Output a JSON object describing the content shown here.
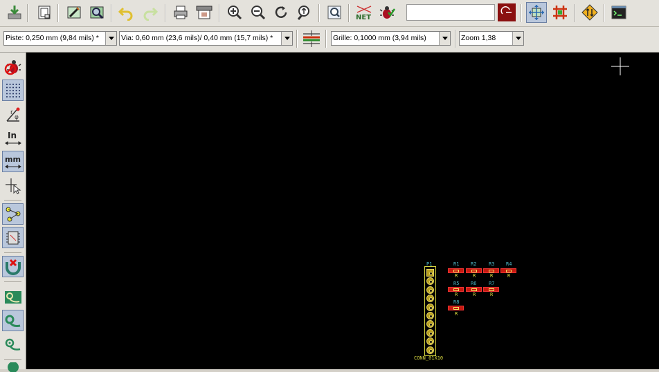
{
  "toolbar": {
    "buttons": [
      {
        "name": "save-board-icon",
        "label": ""
      },
      {
        "name": "page-settings-icon",
        "label": ""
      },
      {
        "name": "load-module-icon",
        "label": ""
      },
      {
        "name": "module-editor-icon",
        "label": ""
      },
      {
        "name": "undo-icon",
        "label": ""
      },
      {
        "name": "redo-icon",
        "label": ""
      },
      {
        "name": "print-icon",
        "label": ""
      },
      {
        "name": "plot-icon",
        "label": ""
      },
      {
        "name": "zoom-in-icon",
        "label": ""
      },
      {
        "name": "zoom-out-icon",
        "label": ""
      },
      {
        "name": "redraw-icon",
        "label": ""
      },
      {
        "name": "zoom-fit-icon",
        "label": ""
      },
      {
        "name": "find-icon",
        "label": ""
      },
      {
        "name": "netlist-icon",
        "label": "NET"
      },
      {
        "name": "drc-icon",
        "label": ""
      },
      {
        "name": "layer-color-icon",
        "label": ""
      },
      {
        "name": "mode-module-icon",
        "label": ""
      },
      {
        "name": "mode-track-icon",
        "label": ""
      },
      {
        "name": "autoroute-icon",
        "label": ""
      },
      {
        "name": "python-console-icon",
        "label": ""
      }
    ],
    "search_value": ""
  },
  "options": {
    "track_width": "Piste: 0,250 mm (9,84 mils) *",
    "via_size": "Via: 0,60 mm (23,6 mils)/ 0,40 mm (15,7 mils) *",
    "grid": "Grille: 0,1000 mm (3,94 mils)",
    "zoom": "Zoom 1,38"
  },
  "board": {
    "connector": {
      "ref": "P1",
      "value": "CONN_01X10",
      "pins": 10
    },
    "resistors_row1": [
      {
        "ref": "R1",
        "value": "R"
      },
      {
        "ref": "R2",
        "value": "R"
      },
      {
        "ref": "R3",
        "value": "R"
      },
      {
        "ref": "R4",
        "value": "R"
      }
    ],
    "resistors_row2": [
      {
        "ref": "R5",
        "value": "R"
      },
      {
        "ref": "R6",
        "value": "R"
      },
      {
        "ref": "R7",
        "value": "R"
      }
    ],
    "resistors_row3": [
      {
        "ref": "R8",
        "value": "R"
      }
    ]
  },
  "colors": {
    "canvas": "#000000",
    "pad": "#c61a10",
    "silkscreen": "#d8d840",
    "reference": "#4fb8c8"
  }
}
